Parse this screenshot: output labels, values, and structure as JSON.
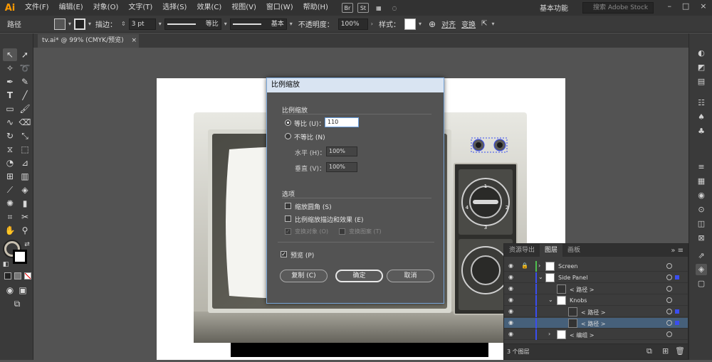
{
  "app": {
    "logo": "Ai"
  },
  "menubar": {
    "items": [
      "文件(F)",
      "编辑(E)",
      "对象(O)",
      "文字(T)",
      "选择(S)",
      "效果(C)",
      "视图(V)",
      "窗口(W)",
      "帮助(H)"
    ],
    "br_icon": "Br",
    "st_icon": "St",
    "workspace": "基本功能",
    "search_placeholder": "搜索 Adobe Stock"
  },
  "controlbar": {
    "selection_label": "路径",
    "stroke_label": "描边：",
    "stroke_value": "3 pt",
    "stroke_profile": "等比",
    "brush": "基本",
    "opacity_label": "不透明度：",
    "opacity_value": "100%",
    "style_label": "样式：",
    "align_label": "对齐",
    "transform_label": "变换"
  },
  "document_tab": {
    "title": "tv.ai* @ 99% (CMYK/预览)",
    "close": "×"
  },
  "dialog": {
    "title": "比例缩放",
    "section_scale": "比例缩放",
    "uniform_label": "等比 (U)：",
    "uniform_value": "110",
    "nonuniform_label": "不等比 (N)",
    "horizontal_label": "水平 (H)：",
    "horizontal_value": "100%",
    "vertical_label": "垂直 (V)：",
    "vertical_value": "100%",
    "section_options": "选项",
    "opt_scale_corners": "缩放圆角 (S)",
    "opt_scale_strokes": "比例缩放描边和效果 (E)",
    "opt_transform_objects": "变换对象 (O)",
    "opt_transform_patterns": "变换图案 (T)",
    "preview_label": "预览 (P)",
    "btn_copy": "复制 (C)",
    "btn_ok": "确定",
    "btn_cancel": "取消"
  },
  "knob": {
    "labels": [
      "1",
      "2",
      "3",
      "4"
    ]
  },
  "layers_panel": {
    "tabs": [
      "资源导出",
      "图层",
      "画板"
    ],
    "active_tab": "图层",
    "rows": [
      {
        "name": "Screen",
        "color": "#4fc04f"
      },
      {
        "name": "Side Panel",
        "color": "#3a4ef0"
      },
      {
        "name": "< 路径 >",
        "color": "#3a4ef0"
      },
      {
        "name": "Knobs",
        "color": "#3a4ef0"
      },
      {
        "name": "< 路径 >",
        "color": "#3a4ef0"
      },
      {
        "name": "< 路径 >",
        "color": "#3a4ef0"
      },
      {
        "name": "< 编组 >",
        "color": "#3a4ef0"
      }
    ],
    "footer": "3 个图层"
  },
  "colors": {
    "chrome_dark": "#323232",
    "panel": "#3a3a3a",
    "canvas": "#535353",
    "accent_selection": "#46607a",
    "dialog_title": "#d9e4f2",
    "logo": "#ff9a00"
  }
}
